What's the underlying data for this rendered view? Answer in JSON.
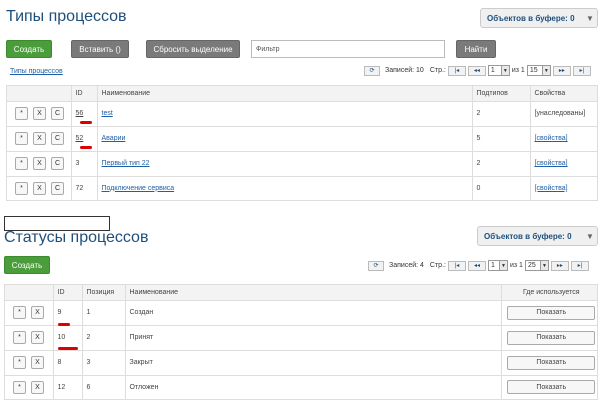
{
  "section1": {
    "title": "Типы процессов",
    "buffer_label": "Объектов в буфере: 0",
    "create_label": "Создать",
    "paste_label": "Вставить ()",
    "reset_label": "Сбросить выделение",
    "filter_placeholder": "Фильтр",
    "find_label": "Найти",
    "breadcrumb": "Типы процессов",
    "pager": {
      "records_label": "Записей: 10",
      "page_label": "Стр.:",
      "page_value": "1",
      "of_label": "из 1",
      "per_page": "15"
    },
    "columns": [
      "",
      "ID",
      "Наименование",
      "Подтипов",
      "Свойства"
    ],
    "rows": [
      {
        "id": "56",
        "name": "test",
        "subtypes": "2",
        "props": "[унаследованы]"
      },
      {
        "id": "52",
        "name": "Аварии",
        "subtypes": "5",
        "props": "[свойства]"
      },
      {
        "id": "3",
        "name": "Первый тип 22",
        "subtypes": "2",
        "props": "[свойства]"
      },
      {
        "id": "72",
        "name": "Подключение сервиса",
        "subtypes": "0",
        "props": "[свойства]"
      }
    ]
  },
  "section2": {
    "title": "Статусы процессов",
    "buffer_label": "Объектов в буфере: 0",
    "create_label": "Создать",
    "pager": {
      "records_label": "Записей: 4",
      "page_label": "Стр.:",
      "page_value": "1",
      "of_label": "из 1",
      "per_page": "25"
    },
    "columns": [
      "",
      "ID",
      "Позиция",
      "Наименование",
      "Где используется"
    ],
    "rows": [
      {
        "id": "9",
        "pos": "1",
        "name": "Создан",
        "action": "Показать"
      },
      {
        "id": "10",
        "pos": "2",
        "name": "Принят",
        "action": "Показать"
      },
      {
        "id": "8",
        "pos": "3",
        "name": "Закрыт",
        "action": "Показать"
      },
      {
        "id": "12",
        "pos": "6",
        "name": "Отложен",
        "action": "Показать"
      }
    ]
  },
  "row_buttons": {
    "star": "*",
    "x": "X",
    "c": "C"
  },
  "pager_icons": {
    "refresh": "⟳",
    "first": "|◂",
    "prev": "◂◂",
    "next": "▸▸",
    "last": "▸|"
  }
}
